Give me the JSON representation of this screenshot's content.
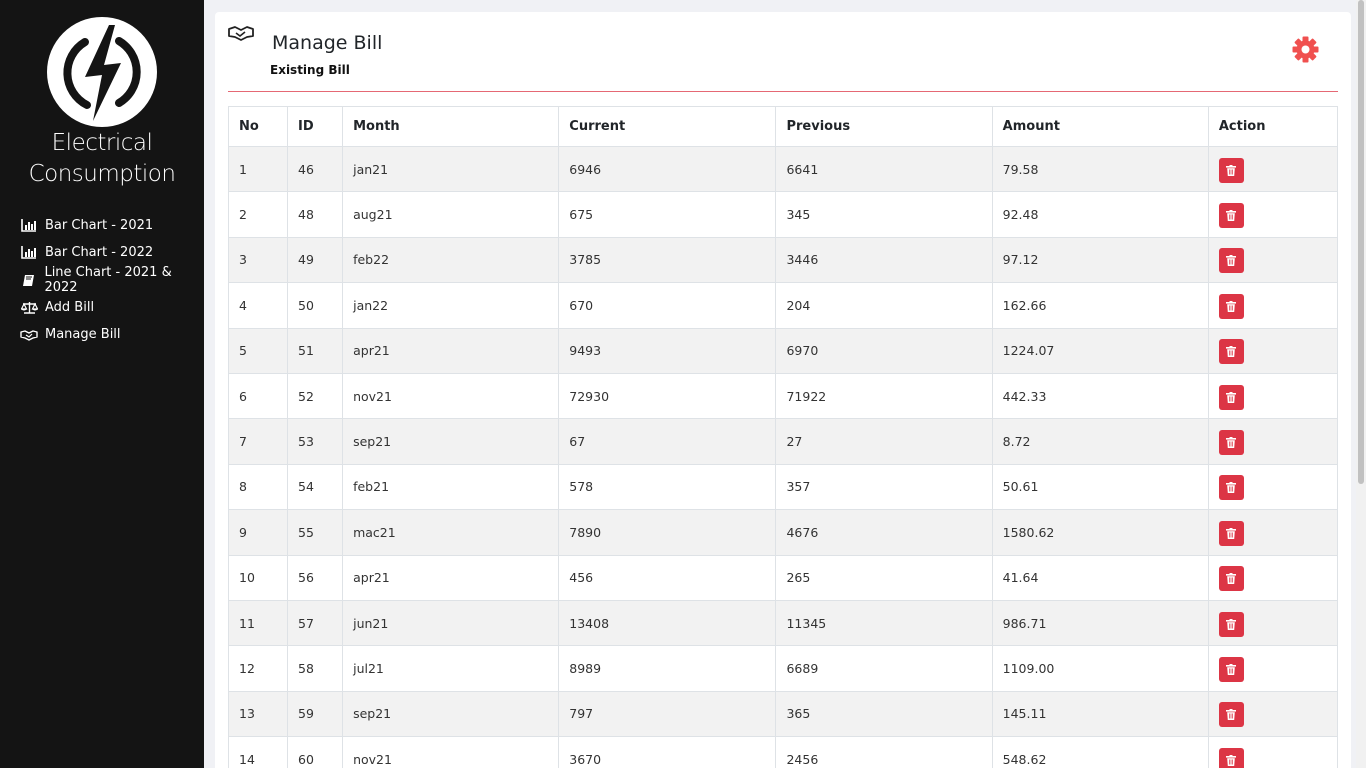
{
  "sidebar": {
    "brand_line1": "Electrical",
    "brand_line2": "Consumption",
    "items": [
      {
        "label": "Bar Chart - 2021",
        "icon": "bar-chart-icon"
      },
      {
        "label": "Bar Chart - 2022",
        "icon": "bar-chart-icon"
      },
      {
        "label": "Line Chart - 2021 & 2022",
        "icon": "book-icon"
      },
      {
        "label": "Add Bill",
        "icon": "balance-scale-icon"
      },
      {
        "label": "Manage Bill",
        "icon": "handshake-icon"
      }
    ]
  },
  "header": {
    "title": "Manage Bill",
    "subtitle": "Existing Bill",
    "icon": "handshake-icon",
    "settings_icon": "gear-icon"
  },
  "colors": {
    "sidebar_bg": "#141414",
    "accent": "#dc3545",
    "gear": "#f0504f"
  },
  "table": {
    "columns": [
      "No",
      "ID",
      "Month",
      "Current",
      "Previous",
      "Amount",
      "Action"
    ],
    "rows": [
      [
        "1",
        "46",
        "jan21",
        "6946",
        "6641",
        "79.58"
      ],
      [
        "2",
        "48",
        "aug21",
        "675",
        "345",
        "92.48"
      ],
      [
        "3",
        "49",
        "feb22",
        "3785",
        "3446",
        "97.12"
      ],
      [
        "4",
        "50",
        "jan22",
        "670",
        "204",
        "162.66"
      ],
      [
        "5",
        "51",
        "apr21",
        "9493",
        "6970",
        "1224.07"
      ],
      [
        "6",
        "52",
        "nov21",
        "72930",
        "71922",
        "442.33"
      ],
      [
        "7",
        "53",
        "sep21",
        "67",
        "27",
        "8.72"
      ],
      [
        "8",
        "54",
        "feb21",
        "578",
        "357",
        "50.61"
      ],
      [
        "9",
        "55",
        "mac21",
        "7890",
        "4676",
        "1580.62"
      ],
      [
        "10",
        "56",
        "apr21",
        "456",
        "265",
        "41.64"
      ],
      [
        "11",
        "57",
        "jun21",
        "13408",
        "11345",
        "986.71"
      ],
      [
        "12",
        "58",
        "jul21",
        "8989",
        "6689",
        "1109.00"
      ],
      [
        "13",
        "59",
        "sep21",
        "797",
        "365",
        "145.11"
      ],
      [
        "14",
        "60",
        "nov21",
        "3670",
        "2456",
        "548.62"
      ]
    ],
    "action_icon": "trash-icon"
  }
}
